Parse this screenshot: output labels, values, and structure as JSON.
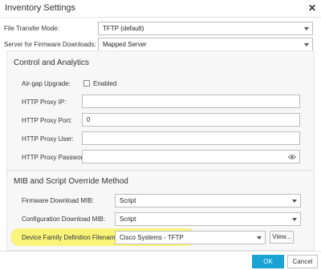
{
  "dialog": {
    "title": "Inventory Settings"
  },
  "fields": {
    "file_transfer_label": "File Transfer Mode:",
    "file_transfer_value": "TFTP (default)",
    "firmware_server_label": "Server for Firmware Downloads:",
    "firmware_server_value": "Mapped Server"
  },
  "control_analytics": {
    "title": "Control and Analytics",
    "airgap_label": "Air-gap Upgrade:",
    "airgap_checkbox_label": "Enabled",
    "airgap_checked": false,
    "proxy_ip_label": "HTTP Proxy IP:",
    "proxy_ip_value": "",
    "proxy_port_label": "HTTP Proxy Port:",
    "proxy_port_value": "0",
    "proxy_user_label": "HTTP Proxy User:",
    "proxy_user_value": "",
    "proxy_password_label": "HTTP Proxy Password:",
    "proxy_password_value": ""
  },
  "mib_script": {
    "title": "MIB and Script Override Method",
    "firmware_mib_label": "Firmware Download MIB:",
    "firmware_mib_value": "Script",
    "config_mib_label": "Configuration Download MIB:",
    "config_mib_value": "Script",
    "device_family_label": "Device Family Definition Filename:",
    "device_family_value": "Cisco Systems - TFTP",
    "view_button": "View..."
  },
  "footer": {
    "ok_label": "OK",
    "cancel_label": "Cancel"
  },
  "colors": {
    "accent": "#1aa3d4",
    "highlight": "#f8f57a"
  },
  "icons": {
    "close": "close-icon",
    "password_visibility": "eye-icon"
  }
}
